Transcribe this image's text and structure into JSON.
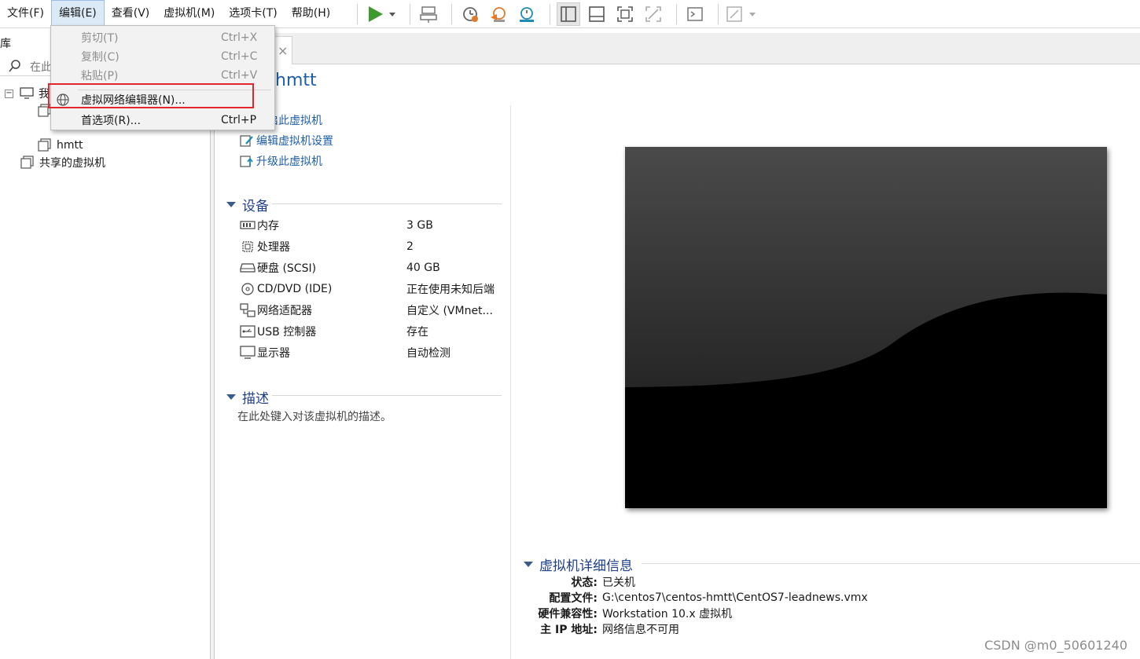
{
  "menubar": {
    "items": [
      "文件(F)",
      "编辑(E)",
      "查看(V)",
      "虚拟机(M)",
      "选项卡(T)",
      "帮助(H)"
    ]
  },
  "edit_menu": {
    "items": [
      {
        "label": "剪切(T)",
        "shortcut": "Ctrl+X",
        "disabled": true
      },
      {
        "label": "复制(C)",
        "shortcut": "Ctrl+C",
        "disabled": true
      },
      {
        "label": "粘贴(P)",
        "shortcut": "Ctrl+V",
        "disabled": true
      },
      {
        "label": "虚拟网络编辑器(N)...",
        "shortcut": "",
        "disabled": false,
        "icon": "globe-icon",
        "highlighted": true
      },
      {
        "label": "首选项(R)...",
        "shortcut": "Ctrl+P",
        "disabled": false
      }
    ]
  },
  "library": {
    "header": "库",
    "search_placeholder": "在此",
    "tree": {
      "my_computer": "我",
      "vm_partial": "",
      "vm_hmtt": "hmtt",
      "shared": "共享的虚拟机"
    }
  },
  "tab": {
    "close": "×"
  },
  "vm": {
    "title": "hmtt",
    "actions": [
      "开启此虚拟机",
      "编辑虚拟机设置",
      "升级此虚拟机"
    ]
  },
  "devices": {
    "heading": "设备",
    "rows": [
      {
        "icon": "memory-icon",
        "name": "内存",
        "value": "3 GB"
      },
      {
        "icon": "cpu-icon",
        "name": "处理器",
        "value": "2"
      },
      {
        "icon": "hard-disk-icon",
        "name": "硬盘 (SCSI)",
        "value": "40 GB"
      },
      {
        "icon": "cd-dvd-icon",
        "name": "CD/DVD (IDE)",
        "value": "正在使用未知后端"
      },
      {
        "icon": "network-adapter-icon",
        "name": "网络适配器",
        "value": "自定义 (VMnet..."
      },
      {
        "icon": "usb-icon",
        "name": "USB 控制器",
        "value": "存在"
      },
      {
        "icon": "display-icon",
        "name": "显示器",
        "value": "自动检测"
      }
    ]
  },
  "description": {
    "heading": "描述",
    "placeholder": "在此处键入对该虚拟机的描述。"
  },
  "details": {
    "heading": "虚拟机详细信息",
    "rows": [
      {
        "label": "状态:",
        "value": "已关机"
      },
      {
        "label": "配置文件:",
        "value": "G:\\centos7\\centos-hmtt\\CentOS7-leadnews.vmx"
      },
      {
        "label": "硬件兼容性:",
        "value": "Workstation 10.x 虚拟机"
      },
      {
        "label": "主 IP 地址:",
        "value": "网络信息不可用"
      }
    ]
  },
  "watermark": "CSDN @m0_50601240",
  "colors": {
    "accent": "#1f5ea8",
    "highlight_border": "#e2262c",
    "play": "#3c9a2e"
  }
}
